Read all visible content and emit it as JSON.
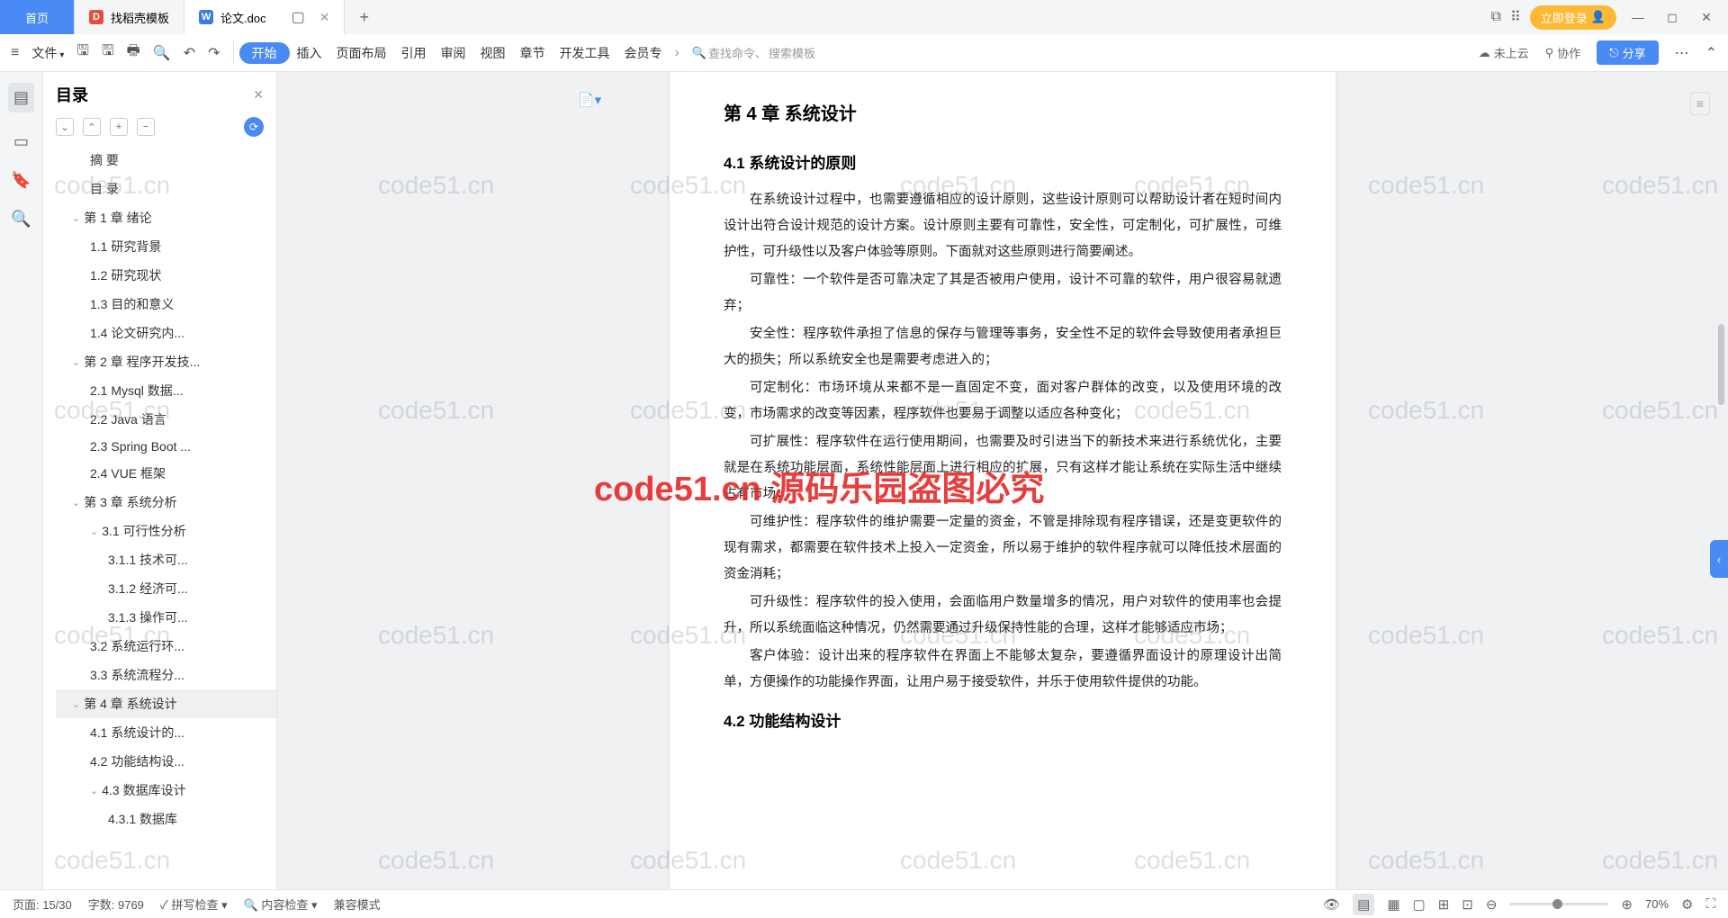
{
  "titlebar": {
    "home": "首页",
    "tab_template": "找稻壳模板",
    "tab_doc": "论文.doc",
    "login": "立即登录"
  },
  "toolbar": {
    "file": "文件",
    "menus": [
      "开始",
      "插入",
      "页面布局",
      "引用",
      "审阅",
      "视图",
      "章节",
      "开发工具",
      "会员专"
    ],
    "search_cmd": "查找命令、",
    "search_tpl": "搜索模板",
    "not_uploaded": "未上云",
    "coop": "协作",
    "share": "分享"
  },
  "sidebar": {
    "title": "目录",
    "items": [
      {
        "lvl": 1,
        "label": "摘  要"
      },
      {
        "lvl": 1,
        "label": "目  录"
      },
      {
        "lvl": 0,
        "label": "第 1 章  绪论",
        "chev": true
      },
      {
        "lvl": 1,
        "label": "1.1  研究背景"
      },
      {
        "lvl": 1,
        "label": "1.2  研究现状"
      },
      {
        "lvl": 1,
        "label": "1.3  目的和意义"
      },
      {
        "lvl": 1,
        "label": "1.4  论文研究内..."
      },
      {
        "lvl": 0,
        "label": "第 2 章  程序开发技...",
        "chev": true
      },
      {
        "lvl": 1,
        "label": "2.1 Mysql 数据..."
      },
      {
        "lvl": 1,
        "label": "2.2 Java 语言"
      },
      {
        "lvl": 1,
        "label": "2.3 Spring Boot ..."
      },
      {
        "lvl": 1,
        "label": "2.4 VUE 框架"
      },
      {
        "lvl": 0,
        "label": "第 3 章  系统分析",
        "chev": true
      },
      {
        "lvl": 1,
        "label": "3.1 可行性分析",
        "chev": true
      },
      {
        "lvl": 2,
        "label": "3.1.1 技术可..."
      },
      {
        "lvl": 2,
        "label": "3.1.2 经济可..."
      },
      {
        "lvl": 2,
        "label": "3.1.3 操作可..."
      },
      {
        "lvl": 1,
        "label": "3.2 系统运行环..."
      },
      {
        "lvl": 1,
        "label": "3.3 系统流程分..."
      },
      {
        "lvl": 0,
        "label": "第 4 章  系统设计",
        "chev": true,
        "active": true
      },
      {
        "lvl": 1,
        "label": "4.1  系统设计的..."
      },
      {
        "lvl": 1,
        "label": "4.2  功能结构设..."
      },
      {
        "lvl": 1,
        "label": "4.3  数据库设计",
        "chev": true
      },
      {
        "lvl": 2,
        "label": "4.3.1 数据库"
      }
    ]
  },
  "doc": {
    "chapter": "第 4 章  系统设计",
    "section": "4.1  系统设计的原则",
    "p1": "在系统设计过程中，也需要遵循相应的设计原则，这些设计原则可以帮助设计者在短时间内设计出符合设计规范的设计方案。设计原则主要有可靠性，安全性，可定制化，可扩展性，可维护性，可升级性以及客户体验等原则。下面就对这些原则进行简要阐述。",
    "p2": "可靠性：一个软件是否可靠决定了其是否被用户使用，设计不可靠的软件，用户很容易就遗弃；",
    "p3": "安全性：程序软件承担了信息的保存与管理等事务，安全性不足的软件会导致使用者承担巨大的损失；所以系统安全也是需要考虑进入的；",
    "p4": "可定制化：市场环境从来都不是一直固定不变，面对客户群体的改变，以及使用环境的改变，市场需求的改变等因素，程序软件也要易于调整以适应各种变化；",
    "p5": "可扩展性：程序软件在运行使用期间，也需要及时引进当下的新技术来进行系统优化，主要就是在系统功能层面，系统性能层面上进行相应的扩展，只有这样才能让系统在实际生活中继续占有市场；",
    "p6": "可维护性：程序软件的维护需要一定量的资金，不管是排除现有程序错误，还是变更软件的现有需求，都需要在软件技术上投入一定资金，所以易于维护的软件程序就可以降低技术层面的资金消耗；",
    "p7": "可升级性：程序软件的投入使用，会面临用户数量增多的情况，用户对软件的使用率也会提升，所以系统面临这种情况，仍然需要通过升级保持性能的合理，这样才能够适应市场；",
    "p8": "客户体验：设计出来的程序软件在界面上不能够太复杂，要遵循界面设计的原理设计出简单，方便操作的功能操作界面，让用户易于接受软件，并乐于使用软件提供的功能。",
    "section2": "4.2  功能结构设计"
  },
  "watermark": {
    "text": "code51.cn",
    "red": "code51.cn 源码乐园盗图必究"
  },
  "status": {
    "page": "页面: 15/30",
    "words": "字数: 9769",
    "spell": "拼写检查",
    "content": "内容检查",
    "compat": "兼容模式",
    "zoom": "70%"
  }
}
